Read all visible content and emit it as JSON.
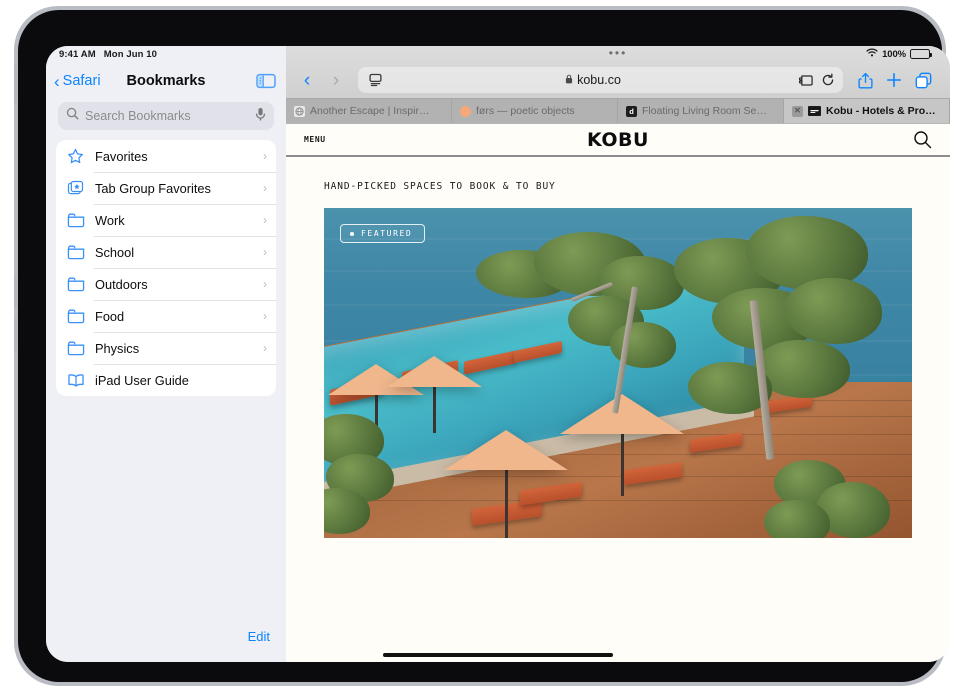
{
  "status_bar": {
    "time": "9:41 AM",
    "date": "Mon Jun 10",
    "battery_percent": "100%",
    "wifi_icon": "wifi-icon"
  },
  "sidebar": {
    "back_label": "Safari",
    "title": "Bookmarks",
    "toggle_icon": "sidebar-toggle-icon",
    "search": {
      "placeholder": "Search Bookmarks",
      "value": "",
      "icon": "search-icon",
      "mic_icon": "microphone-icon"
    },
    "items": [
      {
        "label": "Favorites",
        "icon": "star-icon",
        "chevron": "›"
      },
      {
        "label": "Tab Group Favorites",
        "icon": "tab-group-star-icon",
        "chevron": "›"
      },
      {
        "label": "Work",
        "icon": "folder-icon",
        "chevron": "›"
      },
      {
        "label": "School",
        "icon": "folder-icon",
        "chevron": "›"
      },
      {
        "label": "Outdoors",
        "icon": "folder-icon",
        "chevron": "›"
      },
      {
        "label": "Food",
        "icon": "folder-icon",
        "chevron": "›"
      },
      {
        "label": "Physics",
        "icon": "folder-icon",
        "chevron": "›"
      },
      {
        "label": "iPad User Guide",
        "icon": "book-icon",
        "chevron": ""
      }
    ],
    "edit_label": "Edit"
  },
  "browser": {
    "grabber": "•••",
    "back_icon": "chevron-left-icon",
    "forward_icon": "chevron-right-icon",
    "address_bar": {
      "page_settings_icon": "page-settings-icon",
      "lock_icon": "🔒",
      "url": "kobu.co",
      "extensions_icon": "extensions-icon",
      "reload_icon": "reload-icon"
    },
    "share_icon": "share-icon",
    "new_tab_icon": "plus-icon",
    "tab_overview_icon": "tab-overview-icon",
    "tabs": [
      {
        "title": "Another Escape | Inspir…",
        "favicon": "globe-icon",
        "active": false,
        "closable": false
      },
      {
        "title": "førs — poetic objects",
        "favicon": "orange-dot-icon",
        "active": false,
        "closable": false
      },
      {
        "title": "Floating Living Room Se…",
        "favicon": "dezeen-d-icon",
        "active": false,
        "closable": false
      },
      {
        "title": "Kobu - Hotels & Propert…",
        "favicon": "kobu-icon",
        "active": true,
        "closable": true
      }
    ]
  },
  "page": {
    "menu_label": "MENU",
    "brand": "KOBU",
    "search_icon": "search-icon",
    "tagline": "HAND-PICKED SPACES TO BOOK & TO BUY",
    "hero": {
      "badge_label": "FEATURED",
      "badge_dot": "status-dot",
      "alt": "Cliffside infinity pool with orange loungers and umbrellas overlooking the ocean"
    }
  },
  "colors": {
    "accent_blue": "#0a84ff",
    "page_background": "#fffdf8",
    "sidebar_background": "#eef0f6",
    "sea": "#3a83a3",
    "pool": "#49bcc9",
    "deck": "#a96a40",
    "umbrella": "#f0b68c",
    "lounger": "#c95c33"
  },
  "home_indicator": "home-indicator"
}
